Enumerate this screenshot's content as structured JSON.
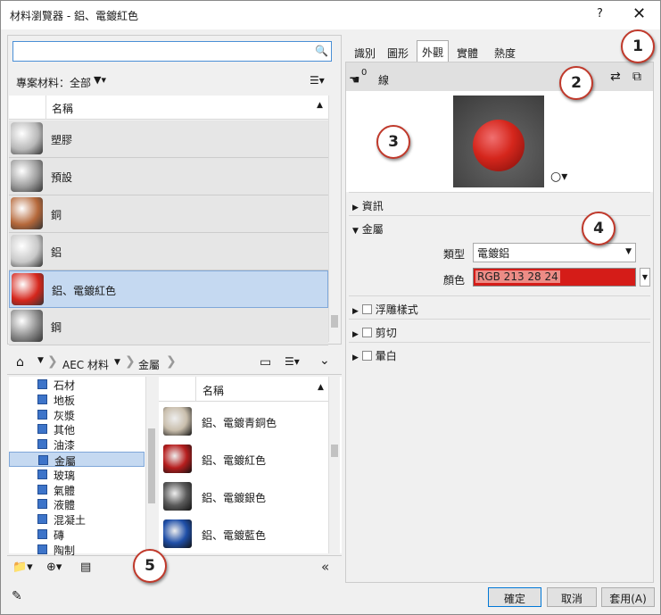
{
  "window": {
    "title": "材料瀏覽器 - 鋁、電鍍紅色",
    "help": "?",
    "close": "✕"
  },
  "search": {
    "placeholder": "",
    "value": ""
  },
  "project": {
    "filter_label": "專案材料：全部",
    "col_name": "名稱"
  },
  "project_materials": [
    {
      "label": "塑膠",
      "color": "#b8b8b8"
    },
    {
      "label": "預設",
      "color": "#9a9a9a"
    },
    {
      "label": "銅",
      "color": "#b5683a"
    },
    {
      "label": "鋁",
      "color": "#c8c8c8"
    },
    {
      "label": "鋁、電鍍紅色",
      "color": "#d5261c",
      "selected": true
    },
    {
      "label": "鋼",
      "color": "#8a8a8a"
    }
  ],
  "breadcrumb": {
    "root": "AEC 材料",
    "current": "金屬"
  },
  "tree": [
    {
      "label": "石材"
    },
    {
      "label": "地板"
    },
    {
      "label": "灰漿"
    },
    {
      "label": "其他"
    },
    {
      "label": "油漆"
    },
    {
      "label": "金屬",
      "selected": true
    },
    {
      "label": "玻璃"
    },
    {
      "label": "氣體"
    },
    {
      "label": "液體"
    },
    {
      "label": "混凝土"
    },
    {
      "label": "磚"
    },
    {
      "label": "陶制"
    }
  ],
  "library": {
    "col_name": "名稱",
    "items": [
      {
        "label": "鋁、電鍍青銅色",
        "color": "#c9beac"
      },
      {
        "label": "鋁、電鍍紅色",
        "color": "#b61e1e"
      },
      {
        "label": "鋁、電鍍銀色",
        "color": "#5a5a5a"
      },
      {
        "label": "鋁、電鍍藍色",
        "color": "#1f4fa8"
      }
    ]
  },
  "tabs": [
    {
      "label": "識別"
    },
    {
      "label": "圖形"
    },
    {
      "label": "外觀",
      "active": true
    },
    {
      "label": "實體"
    },
    {
      "label": "熱度"
    }
  ],
  "appearance": {
    "usage_count": "0",
    "usage_label": "線",
    "sections": {
      "info": "資訊",
      "metal": "金屬",
      "relief": "浮雕樣式",
      "cutout": "剪切",
      "tint": "暈白"
    },
    "type_label": "類型",
    "type_value": "電鍍鋁",
    "color_label": "顏色",
    "color_value": "RGB 213 28 24",
    "color_swatch": "#d51c18"
  },
  "callouts": [
    "1",
    "2",
    "3",
    "4",
    "5"
  ],
  "buttons": {
    "ok": "確定",
    "cancel": "取消",
    "apply": "套用(A)"
  }
}
